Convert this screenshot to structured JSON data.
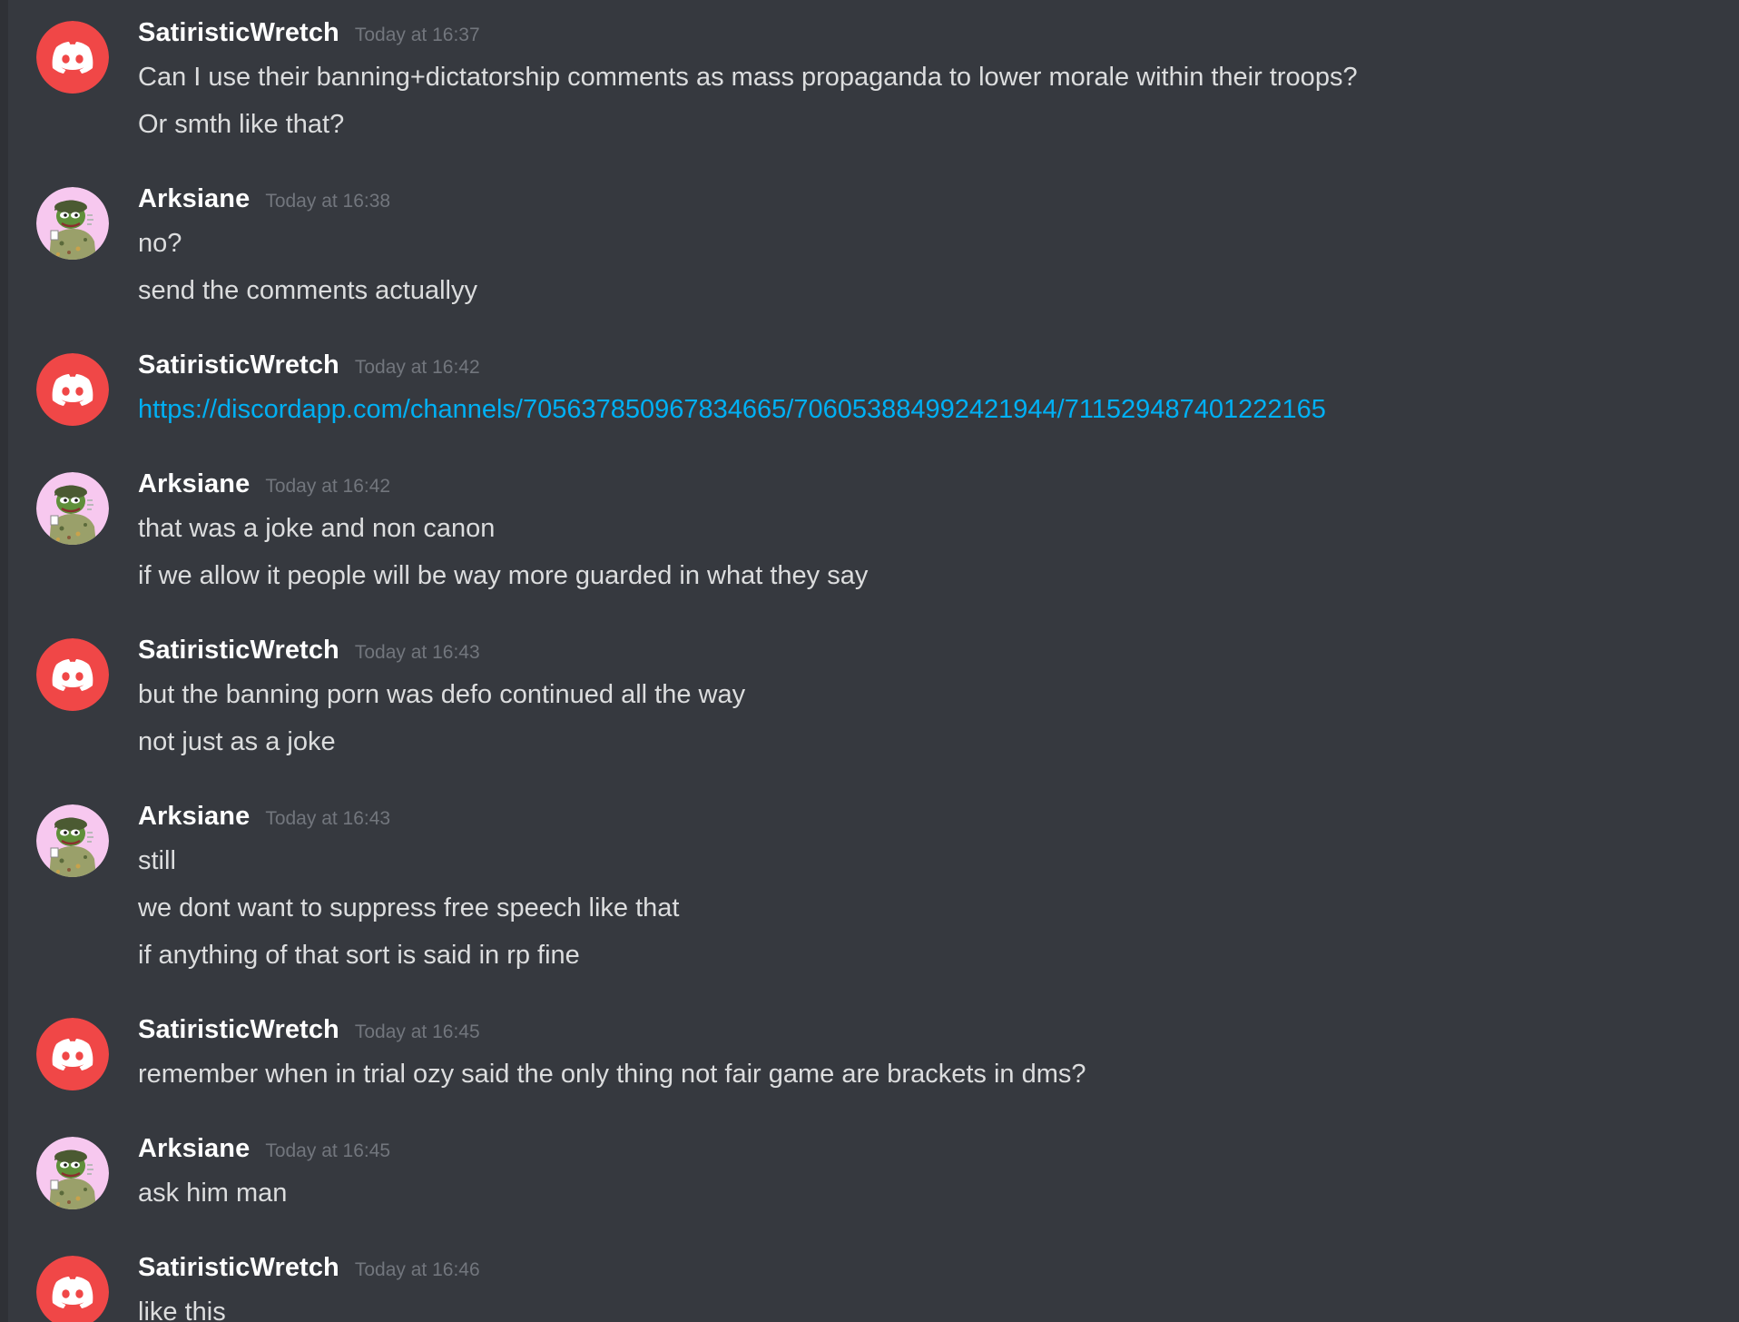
{
  "colors": {
    "background": "#36393f",
    "username": "#ffffff",
    "message_text": "#dcddde",
    "timestamp": "#72767d",
    "link": "#00b0f4",
    "discord_default_avatar": "#f04747"
  },
  "messages": [
    {
      "author": "SatiristicWretch",
      "avatar_icon": "discord-default-avatar-icon",
      "timestamp": "Today at 16:37",
      "lines": [
        "Can I use their banning+dictatorship comments as mass propaganda to lower morale within their troops?",
        "Or smth like that?"
      ]
    },
    {
      "author": "Arksiane",
      "avatar_icon": "frog-soldier-avatar-icon",
      "timestamp": "Today at 16:38",
      "lines": [
        "no?",
        "send the comments actuallyy"
      ]
    },
    {
      "author": "SatiristicWretch",
      "avatar_icon": "discord-default-avatar-icon",
      "timestamp": "Today at 16:42",
      "lines": [
        "https://discordapp.com/channels/705637850967834665/706053884992421944/711529487401222165"
      ]
    },
    {
      "author": "Arksiane",
      "avatar_icon": "frog-soldier-avatar-icon",
      "timestamp": "Today at 16:42",
      "lines": [
        "that was a joke and non canon",
        "if we allow it people will be way more guarded in what they say"
      ]
    },
    {
      "author": "SatiristicWretch",
      "avatar_icon": "discord-default-avatar-icon",
      "timestamp": "Today at 16:43",
      "lines": [
        "but the banning porn was defo continued all the way",
        "not just as a joke"
      ]
    },
    {
      "author": "Arksiane",
      "avatar_icon": "frog-soldier-avatar-icon",
      "timestamp": "Today at 16:43",
      "lines": [
        "still",
        "we dont want to suppress free speech like that",
        "if anything of that sort is said in rp fine"
      ]
    },
    {
      "author": "SatiristicWretch",
      "avatar_icon": "discord-default-avatar-icon",
      "timestamp": "Today at 16:45",
      "lines": [
        "remember when in trial ozy said the only thing not fair game are brackets in dms?"
      ]
    },
    {
      "author": "Arksiane",
      "avatar_icon": "frog-soldier-avatar-icon",
      "timestamp": "Today at 16:45",
      "lines": [
        "ask him man"
      ]
    },
    {
      "author": "SatiristicWretch",
      "avatar_icon": "discord-default-avatar-icon",
      "timestamp": "Today at 16:46",
      "lines": [
        "like this"
      ]
    }
  ]
}
